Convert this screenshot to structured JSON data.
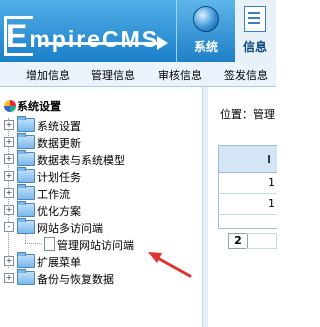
{
  "app": {
    "logo_lead": "E",
    "logo_rest": "mpireCMS"
  },
  "top_tabs": [
    {
      "label": "系统",
      "icon": "globe-icon"
    },
    {
      "label": "信息",
      "icon": "document-icon"
    }
  ],
  "menubar": {
    "items": [
      "增加信息",
      "管理信息",
      "审核信息",
      "签发信息"
    ]
  },
  "sidebar": {
    "root": {
      "label": "系统设置",
      "icon": "system-settings-icon"
    },
    "items": [
      {
        "label": "系统设置",
        "expander": "+"
      },
      {
        "label": "数据更新",
        "expander": "+"
      },
      {
        "label": "数据表与系统模型",
        "expander": "+"
      },
      {
        "label": "计划任务",
        "expander": "+"
      },
      {
        "label": "工作流",
        "expander": "+"
      },
      {
        "label": "优化方案",
        "expander": "+"
      },
      {
        "label": "网站多访问端",
        "expander": "-"
      },
      {
        "label": "管理网站访问端",
        "child": true
      },
      {
        "label": "扩展菜单",
        "expander": "+"
      },
      {
        "label": "备份与恢复数据",
        "expander": "+"
      }
    ]
  },
  "main": {
    "breadcrumb": "位置：管理",
    "table_header": "I",
    "cells": [
      "1",
      "1"
    ],
    "page_number": "2"
  },
  "colors": {
    "header_blue": "#2a8fd6",
    "menubar_bg": "#eaf3fb",
    "annotation_arrow": "#e0322f"
  }
}
